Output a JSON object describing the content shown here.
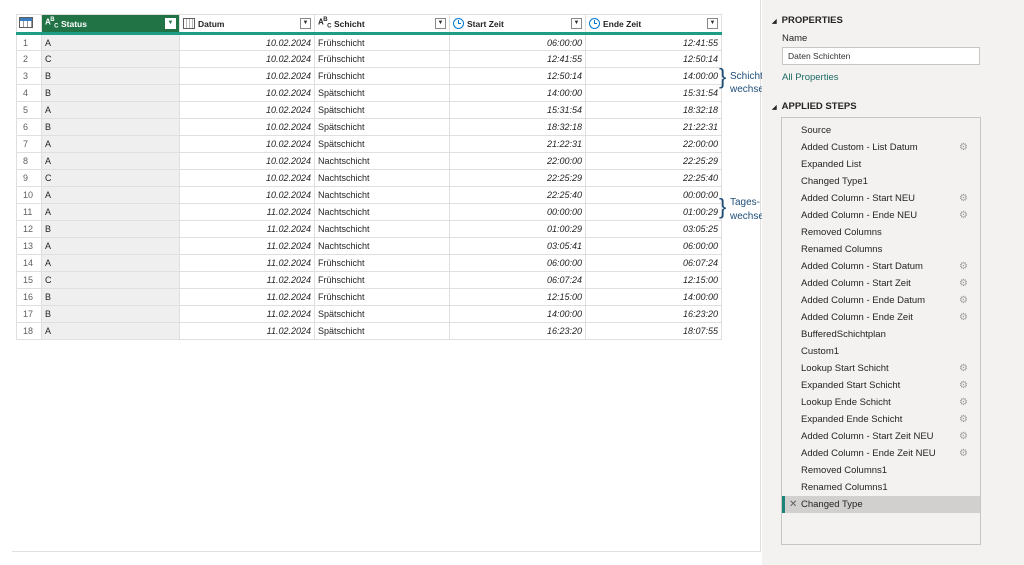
{
  "grid": {
    "columns": [
      {
        "label": "Status",
        "type": "ABC"
      },
      {
        "label": "Datum",
        "type": "date"
      },
      {
        "label": "Schicht",
        "type": "ABC"
      },
      {
        "label": "Start Zeit",
        "type": "time"
      },
      {
        "label": "Ende Zeit",
        "type": "time"
      }
    ],
    "rows": [
      {
        "n": "1",
        "status": "A",
        "datum": "10.02.2024",
        "schicht": "Frühschicht",
        "start": "06:00:00",
        "ende": "12:41:55"
      },
      {
        "n": "2",
        "status": "C",
        "datum": "10.02.2024",
        "schicht": "Frühschicht",
        "start": "12:41:55",
        "ende": "12:50:14"
      },
      {
        "n": "3",
        "status": "B",
        "datum": "10.02.2024",
        "schicht": "Frühschicht",
        "start": "12:50:14",
        "ende": "14:00:00"
      },
      {
        "n": "4",
        "status": "B",
        "datum": "10.02.2024",
        "schicht": "Spätschicht",
        "start": "14:00:00",
        "ende": "15:31:54"
      },
      {
        "n": "5",
        "status": "A",
        "datum": "10.02.2024",
        "schicht": "Spätschicht",
        "start": "15:31:54",
        "ende": "18:32:18"
      },
      {
        "n": "6",
        "status": "B",
        "datum": "10.02.2024",
        "schicht": "Spätschicht",
        "start": "18:32:18",
        "ende": "21:22:31"
      },
      {
        "n": "7",
        "status": "A",
        "datum": "10.02.2024",
        "schicht": "Spätschicht",
        "start": "21:22:31",
        "ende": "22:00:00"
      },
      {
        "n": "8",
        "status": "A",
        "datum": "10.02.2024",
        "schicht": "Nachtschicht",
        "start": "22:00:00",
        "ende": "22:25:29"
      },
      {
        "n": "9",
        "status": "C",
        "datum": "10.02.2024",
        "schicht": "Nachtschicht",
        "start": "22:25:29",
        "ende": "22:25:40"
      },
      {
        "n": "10",
        "status": "A",
        "datum": "10.02.2024",
        "schicht": "Nachtschicht",
        "start": "22:25:40",
        "ende": "00:00:00"
      },
      {
        "n": "11",
        "status": "A",
        "datum": "11.02.2024",
        "schicht": "Nachtschicht",
        "start": "00:00:00",
        "ende": "01:00:29"
      },
      {
        "n": "12",
        "status": "B",
        "datum": "11.02.2024",
        "schicht": "Nachtschicht",
        "start": "01:00:29",
        "ende": "03:05:25"
      },
      {
        "n": "13",
        "status": "A",
        "datum": "11.02.2024",
        "schicht": "Nachtschicht",
        "start": "03:05:41",
        "ende": "06:00:00"
      },
      {
        "n": "14",
        "status": "A",
        "datum": "11.02.2024",
        "schicht": "Frühschicht",
        "start": "06:00:00",
        "ende": "06:07:24"
      },
      {
        "n": "15",
        "status": "C",
        "datum": "11.02.2024",
        "schicht": "Frühschicht",
        "start": "06:07:24",
        "ende": "12:15:00"
      },
      {
        "n": "16",
        "status": "B",
        "datum": "11.02.2024",
        "schicht": "Frühschicht",
        "start": "12:15:00",
        "ende": "14:00:00"
      },
      {
        "n": "17",
        "status": "B",
        "datum": "11.02.2024",
        "schicht": "Spätschicht",
        "start": "14:00:00",
        "ende": "16:23:20"
      },
      {
        "n": "18",
        "status": "A",
        "datum": "11.02.2024",
        "schicht": "Spätschicht",
        "start": "16:23:20",
        "ende": "18:07:55"
      }
    ]
  },
  "annotations": {
    "schicht_line1": "Schicht-",
    "schicht_line2": "wechsel",
    "tages_line1": "Tages-",
    "tages_line2": "wechsel"
  },
  "properties": {
    "title": "PROPERTIES",
    "name_label": "Name",
    "name_value": "Daten Schichten",
    "all_properties": "All Properties"
  },
  "applied_steps": {
    "title": "APPLIED STEPS",
    "steps": [
      {
        "label": "Source",
        "gear": false
      },
      {
        "label": "Added Custom - List Datum",
        "gear": true
      },
      {
        "label": "Expanded List",
        "gear": false
      },
      {
        "label": "Changed Type1",
        "gear": false
      },
      {
        "label": "Added Column - Start NEU",
        "gear": true
      },
      {
        "label": "Added Column - Ende NEU",
        "gear": true
      },
      {
        "label": "Removed Columns",
        "gear": false
      },
      {
        "label": "Renamed Columns",
        "gear": false
      },
      {
        "label": "Added Column - Start Datum",
        "gear": true
      },
      {
        "label": "Added Column - Start Zeit",
        "gear": true
      },
      {
        "label": "Added Column - Ende Datum",
        "gear": true
      },
      {
        "label": "Added Column - Ende Zeit",
        "gear": true
      },
      {
        "label": "BufferedSchichtplan",
        "gear": false
      },
      {
        "label": "Custom1",
        "gear": false
      },
      {
        "label": "Lookup Start Schicht",
        "gear": true
      },
      {
        "label": "Expanded Start Schicht",
        "gear": true
      },
      {
        "label": "Lookup Ende Schicht",
        "gear": true
      },
      {
        "label": "Expanded Ende Schicht",
        "gear": true
      },
      {
        "label": "Added Column - Start Zeit NEU",
        "gear": true
      },
      {
        "label": "Added Column - Ende Zeit NEU",
        "gear": true
      },
      {
        "label": "Removed Columns1",
        "gear": false
      },
      {
        "label": "Renamed Columns1",
        "gear": false
      },
      {
        "label": "Changed Type",
        "gear": false,
        "selected": true
      }
    ]
  },
  "colors": {
    "status_header": "#217346",
    "header_underline": "#1d9c86",
    "selected_step_accent": "#1a8478",
    "annotation": "#1f4e79"
  }
}
